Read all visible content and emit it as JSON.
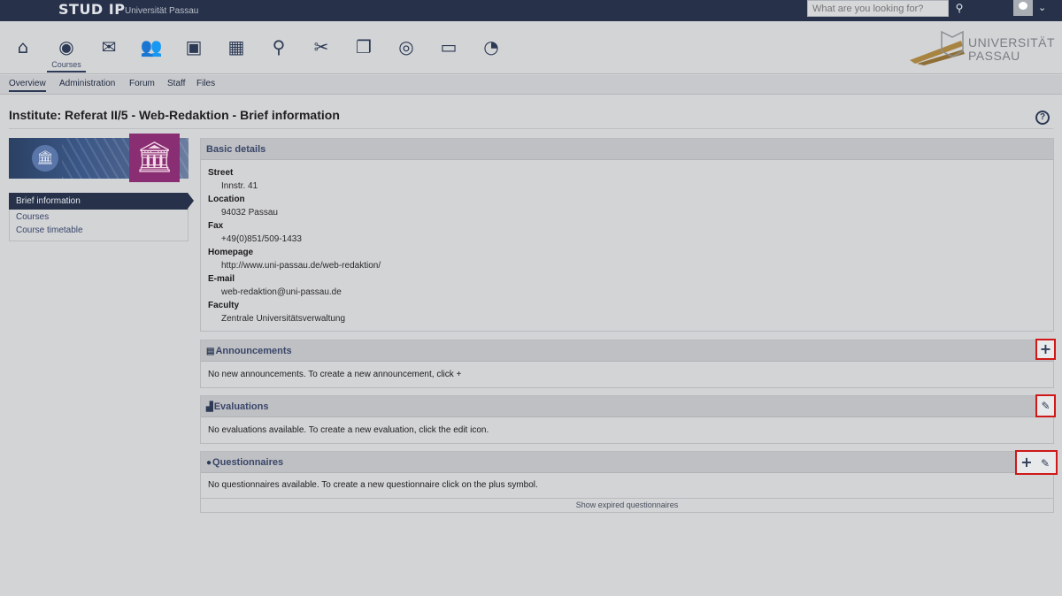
{
  "topbar": {
    "logo": "STUD IP",
    "subtitle": "Universität Passau",
    "search_placeholder": "What are you looking for?",
    "search_icon": "search-icon",
    "avatar_icon": "user-avatar-icon"
  },
  "nav": {
    "items": [
      {
        "icon": "home-icon",
        "glyph": "⌂"
      },
      {
        "icon": "courses-icon",
        "glyph": "◉"
      },
      {
        "icon": "messages-icon",
        "glyph": "✉"
      },
      {
        "icon": "community-icon",
        "glyph": "👥"
      },
      {
        "icon": "profile-icon",
        "glyph": "▣"
      },
      {
        "icon": "schedule-icon",
        "glyph": "▦"
      },
      {
        "icon": "search-icon",
        "glyph": "⚲"
      },
      {
        "icon": "tools-icon",
        "glyph": "✂"
      },
      {
        "icon": "files-icon",
        "glyph": "❐"
      },
      {
        "icon": "plugin-icon",
        "glyph": "◎"
      },
      {
        "icon": "card-icon",
        "glyph": "▭"
      },
      {
        "icon": "stats-icon",
        "glyph": "◔"
      }
    ],
    "active_label": "Courses",
    "university_logo_text": "UNIVERSITÄT PASSAU"
  },
  "tabs": [
    "Overview",
    "Administration",
    "Forum",
    "Staff",
    "Files"
  ],
  "page": {
    "title": "Institute: Referat II/5 - Web-Redaktion - Brief information",
    "help_glyph": "?"
  },
  "sidebar": {
    "items": [
      "Brief information",
      "Courses",
      "Course timetable"
    ]
  },
  "basic_details": {
    "title": "Basic details",
    "fields": [
      {
        "label": "Street",
        "value": "Innstr. 41"
      },
      {
        "label": "Location",
        "value": "94032 Passau"
      },
      {
        "label": "Fax",
        "value": "+49(0)851/509-1433"
      },
      {
        "label": "Homepage",
        "value": "http://www.uni-passau.de/web-redaktion/"
      },
      {
        "label": "E-mail",
        "value": "web-redaktion@uni-passau.de"
      },
      {
        "label": "Faculty",
        "value": "Zentrale Universitätsverwaltung"
      }
    ]
  },
  "announcements": {
    "title": "Announcements",
    "message": "No new announcements. To create a new announcement, click +"
  },
  "evaluations": {
    "title": "Evaluations",
    "message": "No evaluations available. To create a new evaluation, click the edit icon."
  },
  "questionnaires": {
    "title": "Questionnaires",
    "message": "No questionnaires available. To create a new questionnaire click on the plus symbol.",
    "expired_link": "Show expired questionnaires"
  },
  "actions": {
    "plus_glyph": "+",
    "edit_glyph": "✎"
  },
  "colors": {
    "header": "#27324a",
    "highlight": "#d01818",
    "institute_badge": "#8a2e73"
  }
}
